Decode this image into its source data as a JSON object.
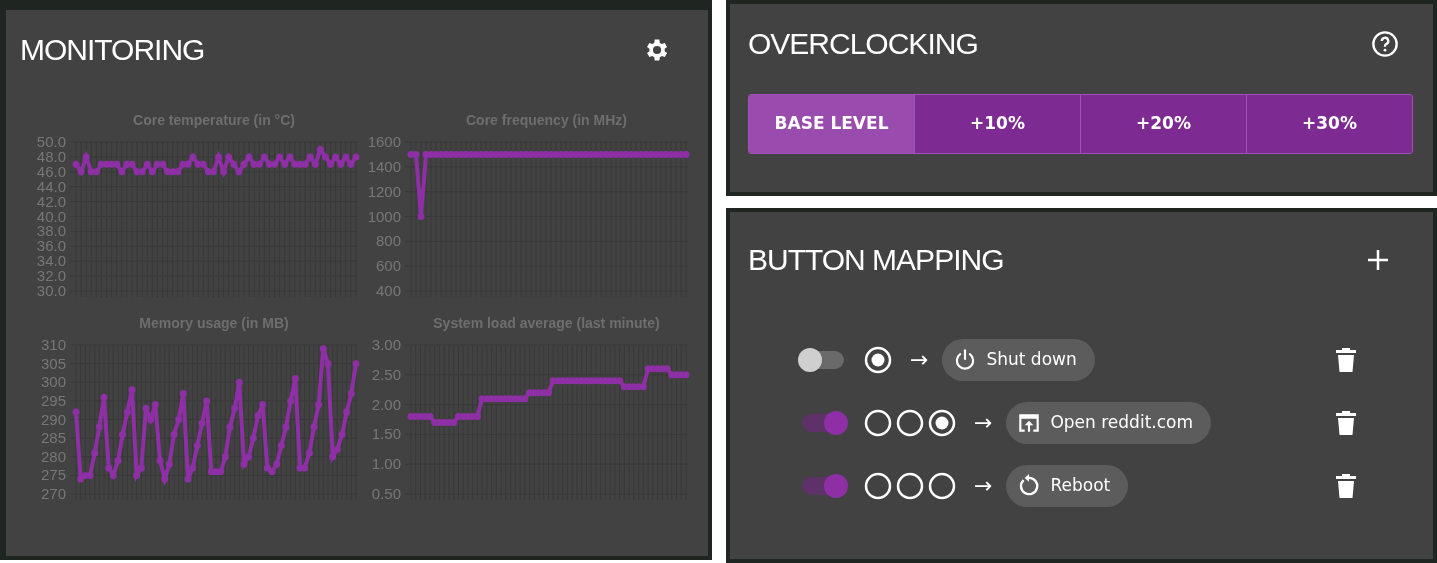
{
  "monitoring": {
    "title": "MONITORING",
    "charts": [
      {
        "chart_data": {
          "type": "line",
          "grid": true,
          "title": "Core temperature (in °C)",
          "ylim": [
            30,
            50
          ],
          "yticks": [
            {
              "value": 30,
              "label": "30.0"
            },
            {
              "value": 32,
              "label": "32.0"
            },
            {
              "value": 34,
              "label": "34.0"
            },
            {
              "value": 36,
              "label": "36.0"
            },
            {
              "value": 38,
              "label": "38.0"
            },
            {
              "value": 40,
              "label": "40.0"
            },
            {
              "value": 42,
              "label": "42.0"
            },
            {
              "value": 44,
              "label": "44.0"
            },
            {
              "value": 46,
              "label": "46.0"
            },
            {
              "value": 48,
              "label": "48.0"
            },
            {
              "value": 50,
              "label": "50.0"
            }
          ],
          "series": [
            {
              "marker": true,
              "color": "#8e2fa6",
              "values": [
                47,
                46,
                48,
                46,
                46,
                47,
                47,
                47,
                47,
                46,
                47,
                47,
                46,
                46,
                47,
                46,
                47,
                47,
                46,
                46,
                46,
                47,
                47,
                48,
                47,
                47,
                46,
                46,
                48,
                46,
                48,
                47,
                46,
                47,
                48,
                47,
                47,
                48,
                47,
                47,
                48,
                47,
                48,
                47,
                47,
                47,
                48,
                47,
                49,
                48,
                47,
                48,
                47,
                48,
                47,
                48
              ]
            }
          ]
        }
      },
      {
        "chart_data": {
          "type": "line",
          "grid": true,
          "title": "Core frequency (in MHz)",
          "ylim": [
            400,
            1600
          ],
          "yticks": [
            400,
            600,
            800,
            1000,
            1200,
            1400,
            1600
          ],
          "series": [
            {
              "marker": true,
              "color": "#8e2fa6",
              "values": [
                1500,
                1500,
                1000,
                1500,
                1500,
                1500,
                1500,
                1500,
                1500,
                1500,
                1500,
                1500,
                1500,
                1500,
                1500,
                1500,
                1500,
                1500,
                1500,
                1500,
                1500,
                1500,
                1500,
                1500,
                1500,
                1500,
                1500,
                1500,
                1500,
                1500,
                1500,
                1500,
                1500,
                1500,
                1500,
                1500,
                1500,
                1500,
                1500,
                1500,
                1500,
                1500,
                1500,
                1500,
                1500,
                1500,
                1500,
                1500,
                1500,
                1500,
                1500,
                1500,
                1500,
                1500,
                1500,
                1500
              ]
            }
          ]
        }
      },
      {
        "chart_data": {
          "type": "line",
          "grid": true,
          "title": "Memory usage (in MB)",
          "ylim": [
            270,
            310
          ],
          "yticks": [
            270,
            275,
            280,
            285,
            290,
            295,
            300,
            305,
            310
          ],
          "series": [
            {
              "marker": true,
              "color": "#8e2fa6",
              "values": [
                292,
                274,
                275,
                275,
                281,
                288,
                296,
                277,
                275,
                279,
                286,
                292,
                298,
                275,
                277,
                293,
                290,
                294,
                279,
                274,
                278,
                286,
                290,
                297,
                274,
                277,
                283,
                289,
                295,
                276,
                276,
                276,
                280,
                288,
                293,
                300,
                278,
                280,
                285,
                291,
                294,
                277,
                276,
                278,
                283,
                288,
                295,
                301,
                277,
                277,
                281,
                288,
                294,
                309,
                305,
                280,
                282,
                286,
                292,
                297,
                305
              ]
            }
          ]
        }
      },
      {
        "chart_data": {
          "type": "line",
          "grid": true,
          "title": "System load average (last minute)",
          "ylim": [
            0.5,
            3
          ],
          "yticks": [
            {
              "value": 0.5,
              "label": "0.50"
            },
            {
              "value": 1,
              "label": "1.00"
            },
            {
              "value": 1.5,
              "label": "1.50"
            },
            {
              "value": 2,
              "label": "2.00"
            },
            {
              "value": 2.5,
              "label": "2.50"
            },
            {
              "value": 3,
              "label": "3.00"
            }
          ],
          "series": [
            {
              "marker": true,
              "color": "#8e2fa6",
              "values": [
                1.8,
                1.8,
                1.8,
                1.8,
                1.8,
                1.7,
                1.7,
                1.7,
                1.7,
                1.7,
                1.8,
                1.8,
                1.8,
                1.8,
                1.8,
                2.1,
                2.1,
                2.1,
                2.1,
                2.1,
                2.1,
                2.1,
                2.1,
                2.1,
                2.1,
                2.2,
                2.2,
                2.2,
                2.2,
                2.2,
                2.4,
                2.4,
                2.4,
                2.4,
                2.4,
                2.4,
                2.4,
                2.4,
                2.4,
                2.4,
                2.4,
                2.4,
                2.4,
                2.4,
                2.4,
                2.3,
                2.3,
                2.3,
                2.3,
                2.3,
                2.6,
                2.6,
                2.6,
                2.6,
                2.6,
                2.5,
                2.5,
                2.5,
                2.5
              ]
            }
          ]
        }
      }
    ]
  },
  "overclocking": {
    "title": "OVERCLOCKING",
    "levels": [
      {
        "label": "BASE LEVEL",
        "selected": true
      },
      {
        "label": "+10%",
        "selected": false
      },
      {
        "label": "+20%",
        "selected": false
      },
      {
        "label": "+30%",
        "selected": false
      }
    ]
  },
  "button_mapping": {
    "title": "BUTTON MAPPING",
    "mappings": [
      {
        "on": false,
        "presses": [
          {
            "held": true
          }
        ],
        "arrow": "→",
        "action": {
          "kind": "shutdown",
          "label": "Shut down"
        }
      },
      {
        "on": true,
        "presses": [
          {
            "held": false
          },
          {
            "held": false
          },
          {
            "held": true
          }
        ],
        "arrow": "→",
        "action": {
          "kind": "url",
          "label": "Open reddit.com"
        }
      },
      {
        "on": true,
        "presses": [
          {
            "held": false
          },
          {
            "held": false
          },
          {
            "held": false
          }
        ],
        "arrow": "→",
        "action": {
          "kind": "reboot",
          "label": "Reboot"
        }
      }
    ]
  }
}
